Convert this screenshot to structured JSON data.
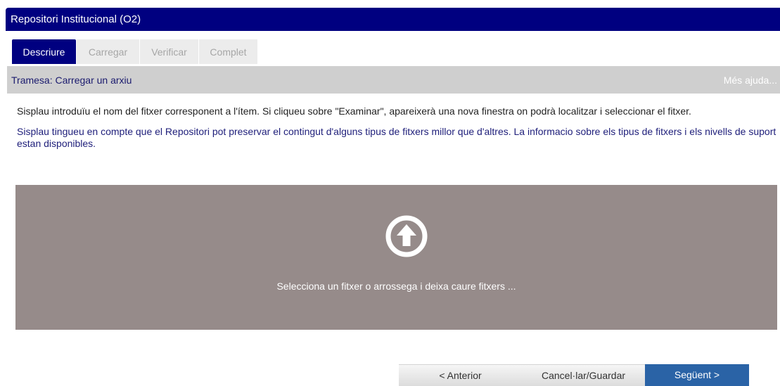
{
  "window": {
    "title": "Repositori Institucional (O2)"
  },
  "tabs": [
    {
      "label": "Descriure",
      "state": "active"
    },
    {
      "label": "Carregar",
      "state": "disabled"
    },
    {
      "label": "Verificar",
      "state": "disabled"
    },
    {
      "label": "Complet",
      "state": "disabled"
    }
  ],
  "section": {
    "title": "Tramesa: Carregar un arxiu",
    "help_link": "Més ajuda..."
  },
  "instructions": {
    "text1": "Sisplau introduïu el nom del fitxer corresponent a l'ítem. Si cliqueu sobre \"Examinar\", apareixerà una nova finestra on podrà localitzar i seleccionar el fitxer.",
    "text2": "Sisplau tingueu en compte que el Repositori pot preservar el contingut d'alguns tipus de fitxers millor que d'altres. La informacio sobre els tipus de fitxers i els nivells de suport estan disponibles."
  },
  "upload": {
    "icon": "upload-arrow-icon",
    "text": "Selecciona un fitxer o arrossega i deixa caure fitxers ..."
  },
  "buttons": {
    "previous": "< Anterior",
    "cancel": "Cancel·lar/Guardar",
    "next": "Següent >"
  },
  "colors": {
    "header": "#000080",
    "section_bar": "#cfcfcf",
    "upload_area": "#968b8a",
    "next_button": "#2a63a6"
  }
}
